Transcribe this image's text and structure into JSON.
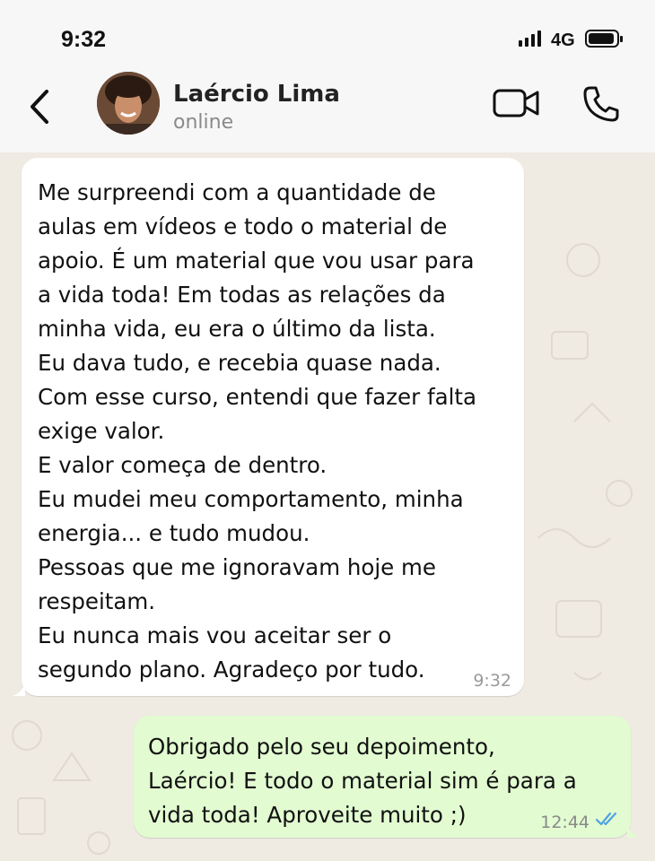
{
  "status_bar": {
    "time": "9:32",
    "network": "4G"
  },
  "header": {
    "contact_name": "Laércio Lima",
    "contact_status": "online"
  },
  "messages": [
    {
      "direction": "incoming",
      "text": "Me surpreendi com a quantidade de\naulas em vídeos e todo o material de\napoio. É um material que vou usar para\na vida toda! Em todas as relações da\nminha vida, eu era o último da lista.\nEu dava tudo, e recebia quase nada.\nCom esse curso, entendi que fazer falta\nexige valor.\nE valor começa de dentro.\nEu mudei meu comportamento, minha\nenergia... e tudo mudou.\nPessoas que me ignoravam hoje me\nrespeitam.\nEu nunca mais vou aceitar ser o\nsegundo plano. Agradeço por tudo.",
      "time": "9:32"
    },
    {
      "direction": "outgoing",
      "text": "Obrigado pelo seu depoimento,\nLaércio! E todo o material sim é para a\nvida toda! Aproveite muito ;)",
      "time": "12:44",
      "read": true
    }
  ],
  "colors": {
    "chat_background": "#efeae2",
    "incoming_bubble": "#ffffff",
    "outgoing_bubble": "#e2fbd1",
    "read_ticks": "#4fa3e0"
  }
}
